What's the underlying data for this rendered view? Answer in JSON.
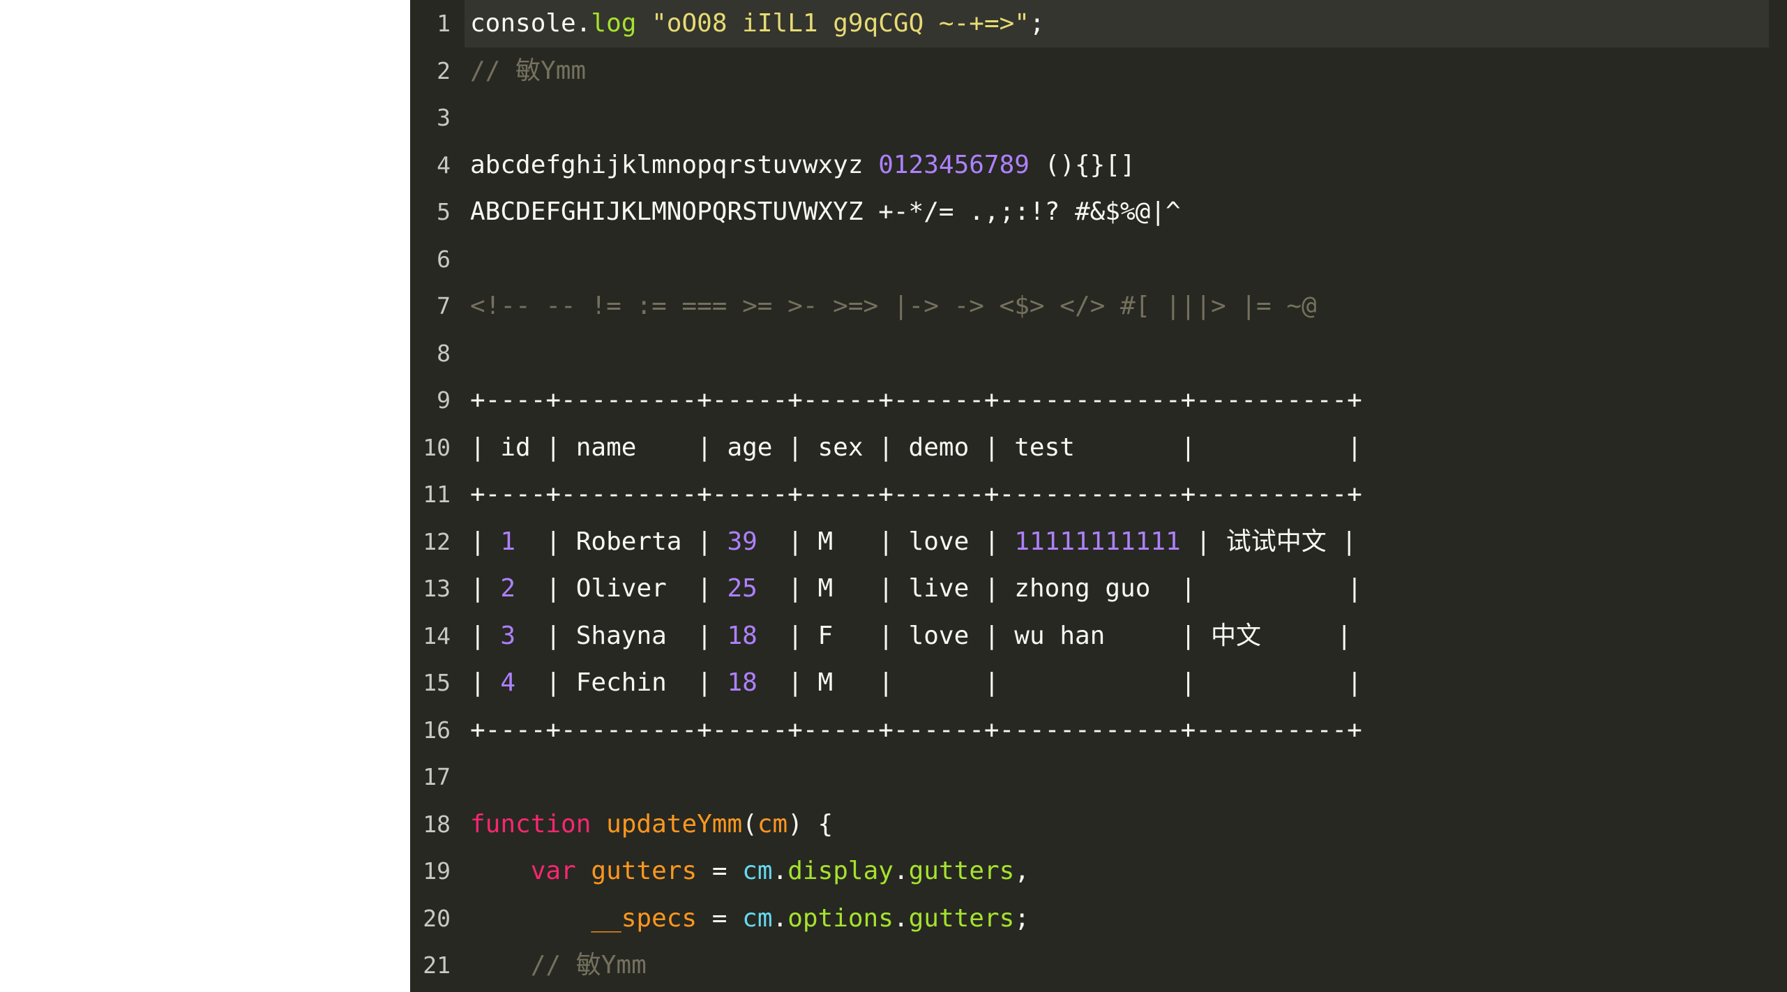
{
  "editor": {
    "theme_name": "monokai",
    "background": "#272822",
    "gutter_background": "#272822",
    "active_line_background": "#34352e",
    "line_number_color": "#c9c9c2",
    "page_background": "#ffffff",
    "colors": {
      "default": "#f8f8f2",
      "comment": "#75715e",
      "string": "#e6db74",
      "number": "#ae81ff",
      "keyword": "#f92672",
      "function": "#fd971f",
      "variable": "#fd971f",
      "parameter": "#66d9ef",
      "property": "#a6e22e"
    },
    "active_line": 1,
    "first_visible_line": 1,
    "last_visible_line": 21
  },
  "lines": [
    {
      "number": "1",
      "active": true,
      "tokens": [
        {
          "text": "console",
          "type": "default"
        },
        {
          "text": ".",
          "type": "punct"
        },
        {
          "text": "log",
          "type": "property"
        },
        {
          "text": " ",
          "type": "default"
        },
        {
          "text": "\"oO08 iIlL1 g9qCGQ ~-+=>\"",
          "type": "string"
        },
        {
          "text": ";",
          "type": "punct"
        }
      ]
    },
    {
      "number": "2",
      "active": false,
      "tokens": [
        {
          "text": "// 敏Ymm",
          "type": "comment"
        }
      ]
    },
    {
      "number": "3",
      "active": false,
      "tokens": []
    },
    {
      "number": "4",
      "active": false,
      "tokens": [
        {
          "text": "abcdefghijklmnopqrstuvwxyz ",
          "type": "default"
        },
        {
          "text": "0123456789",
          "type": "number"
        },
        {
          "text": " (){}[]",
          "type": "default"
        }
      ]
    },
    {
      "number": "5",
      "active": false,
      "tokens": [
        {
          "text": "ABCDEFGHIJKLMNOPQRSTUVWXYZ +-*/= .,;:!? #&$%@|^",
          "type": "default"
        }
      ]
    },
    {
      "number": "6",
      "active": false,
      "tokens": []
    },
    {
      "number": "7",
      "active": false,
      "tokens": [
        {
          "text": "<!-- -- != := === >= >- >=> |-> -> <$> </> #[ |||> |= ~@",
          "type": "comment"
        }
      ]
    },
    {
      "number": "8",
      "active": false,
      "tokens": []
    },
    {
      "number": "9",
      "active": false,
      "tokens": [
        {
          "text": "+----+---------+-----+-----+------+------------+----------+",
          "type": "default"
        }
      ]
    },
    {
      "number": "10",
      "active": false,
      "tokens": [
        {
          "text": "| id | name    | age | sex | demo | test       |          |",
          "type": "default"
        }
      ]
    },
    {
      "number": "11",
      "active": false,
      "tokens": [
        {
          "text": "+----+---------+-----+-----+------+------------+----------+",
          "type": "default"
        }
      ]
    },
    {
      "number": "12",
      "active": false,
      "tokens": [
        {
          "text": "| ",
          "type": "default"
        },
        {
          "text": "1",
          "type": "number"
        },
        {
          "text": "  | Roberta | ",
          "type": "default"
        },
        {
          "text": "39",
          "type": "number"
        },
        {
          "text": "  | M   | love | ",
          "type": "default"
        },
        {
          "text": "11111111111",
          "type": "number"
        },
        {
          "text": " | 试试中文 |",
          "type": "default"
        }
      ]
    },
    {
      "number": "13",
      "active": false,
      "tokens": [
        {
          "text": "| ",
          "type": "default"
        },
        {
          "text": "2",
          "type": "number"
        },
        {
          "text": "  | Oliver  | ",
          "type": "default"
        },
        {
          "text": "25",
          "type": "number"
        },
        {
          "text": "  | M   | live | zhong guo  |          |",
          "type": "default"
        }
      ]
    },
    {
      "number": "14",
      "active": false,
      "tokens": [
        {
          "text": "| ",
          "type": "default"
        },
        {
          "text": "3",
          "type": "number"
        },
        {
          "text": "  | Shayna  | ",
          "type": "default"
        },
        {
          "text": "18",
          "type": "number"
        },
        {
          "text": "  | F   | love | wu han     | 中文     |",
          "type": "default"
        }
      ]
    },
    {
      "number": "15",
      "active": false,
      "tokens": [
        {
          "text": "| ",
          "type": "default"
        },
        {
          "text": "4",
          "type": "number"
        },
        {
          "text": "  | Fechin  | ",
          "type": "default"
        },
        {
          "text": "18",
          "type": "number"
        },
        {
          "text": "  | M   |      |            |          |",
          "type": "default"
        }
      ]
    },
    {
      "number": "16",
      "active": false,
      "tokens": [
        {
          "text": "+----+---------+-----+-----+------+------------+----------+",
          "type": "default"
        }
      ]
    },
    {
      "number": "17",
      "active": false,
      "tokens": []
    },
    {
      "number": "18",
      "active": false,
      "tokens": [
        {
          "text": "function",
          "type": "keyword"
        },
        {
          "text": " ",
          "type": "default"
        },
        {
          "text": "updateYmm",
          "type": "function"
        },
        {
          "text": "(",
          "type": "punct"
        },
        {
          "text": "cm",
          "type": "function"
        },
        {
          "text": ") {",
          "type": "punct"
        }
      ]
    },
    {
      "number": "19",
      "active": false,
      "tokens": [
        {
          "text": "    ",
          "type": "default"
        },
        {
          "text": "var",
          "type": "keyword"
        },
        {
          "text": " ",
          "type": "default"
        },
        {
          "text": "gutters",
          "type": "variable"
        },
        {
          "text": " = ",
          "type": "operator"
        },
        {
          "text": "cm",
          "type": "param"
        },
        {
          "text": ".",
          "type": "punct"
        },
        {
          "text": "display",
          "type": "property"
        },
        {
          "text": ".",
          "type": "punct"
        },
        {
          "text": "gutters",
          "type": "property"
        },
        {
          "text": ",",
          "type": "punct"
        }
      ]
    },
    {
      "number": "20",
      "active": false,
      "tokens": [
        {
          "text": "        ",
          "type": "default"
        },
        {
          "text": "__specs",
          "type": "variable"
        },
        {
          "text": " = ",
          "type": "operator"
        },
        {
          "text": "cm",
          "type": "param"
        },
        {
          "text": ".",
          "type": "punct"
        },
        {
          "text": "options",
          "type": "property"
        },
        {
          "text": ".",
          "type": "punct"
        },
        {
          "text": "gutters",
          "type": "property"
        },
        {
          "text": ";",
          "type": "punct"
        }
      ]
    },
    {
      "number": "21",
      "active": false,
      "tokens": [
        {
          "text": "    // 敏Ymm",
          "type": "comment"
        }
      ]
    }
  ]
}
